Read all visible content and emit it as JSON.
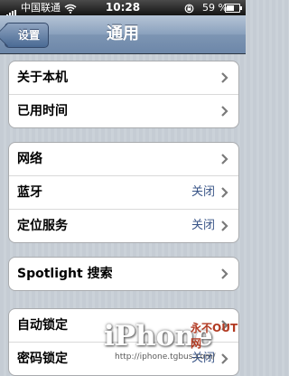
{
  "status_bar": {
    "carrier": "中国联通",
    "time": "10:28",
    "battery_percent": "59 %",
    "battery_level": 0.59,
    "icons": [
      "signal-icon",
      "wifi-icon",
      "lock-rotation-icon",
      "battery-icon"
    ]
  },
  "nav": {
    "back_label": "设置",
    "title": "通用"
  },
  "groups": [
    {
      "rows": [
        {
          "label": "关于本机",
          "value": ""
        },
        {
          "label": "已用时间",
          "value": ""
        }
      ]
    },
    {
      "rows": [
        {
          "label": "网络",
          "value": ""
        },
        {
          "label": "蓝牙",
          "value": "关闭"
        },
        {
          "label": "定位服务",
          "value": "关闭"
        }
      ]
    },
    {
      "rows": [
        {
          "label": "Spotlight 搜索",
          "value": ""
        }
      ]
    },
    {
      "rows": [
        {
          "label": "自动锁定",
          "value": ""
        },
        {
          "label": "密码锁定",
          "value": "关闭"
        }
      ]
    }
  ],
  "watermark": {
    "logo_text": "iPhone",
    "cn_text": "永不OUT网",
    "url": "http://iphone.tgbus.com/"
  },
  "colors": {
    "value_text": "#385487",
    "navbar": "#7d95b3",
    "background": "#c5ccd4"
  }
}
